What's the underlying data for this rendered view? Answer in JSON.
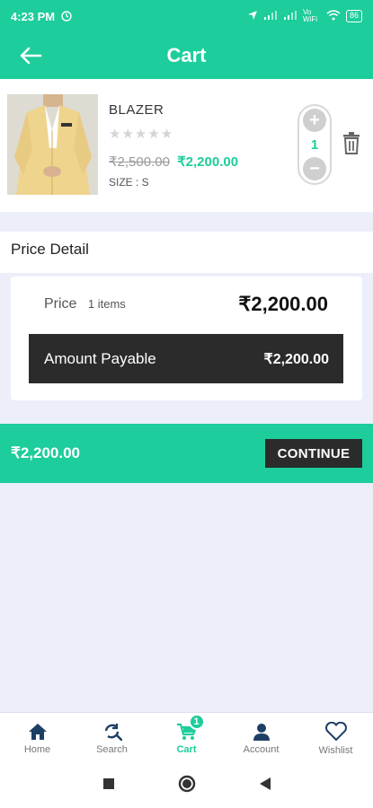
{
  "status_bar": {
    "time": "4:23 PM",
    "network": "Vo WiFi",
    "battery": "86"
  },
  "header": {
    "title": "Cart"
  },
  "cart_item": {
    "name": "BLAZER",
    "rating_stars": "★★★★★",
    "old_price": "₹2,500.00",
    "price": "₹2,200.00",
    "size": "SIZE : S",
    "quantity": "1",
    "plus": "+",
    "minus": "−"
  },
  "price_detail": {
    "title": "Price Detail",
    "price_label": "Price",
    "items_label": "1 items",
    "price_value": "₹2,200.00",
    "payable_label": "Amount Payable",
    "payable_value": "₹2,200.00"
  },
  "checkout": {
    "total": "₹2,200.00",
    "continue_label": "CONTINUE"
  },
  "bottom_nav": {
    "items": [
      {
        "label": "Home",
        "icon": "home-icon"
      },
      {
        "label": "Search",
        "icon": "search-icon"
      },
      {
        "label": "Cart",
        "icon": "cart-icon",
        "badge": "1",
        "active": true
      },
      {
        "label": "Account",
        "icon": "account-icon"
      },
      {
        "label": "Wishlist",
        "icon": "heart-icon"
      }
    ]
  },
  "colors": {
    "accent": "#1dcd9b",
    "dark": "#2b2b2b",
    "background": "#eceff9",
    "nav_icon": "#1d3f66"
  }
}
